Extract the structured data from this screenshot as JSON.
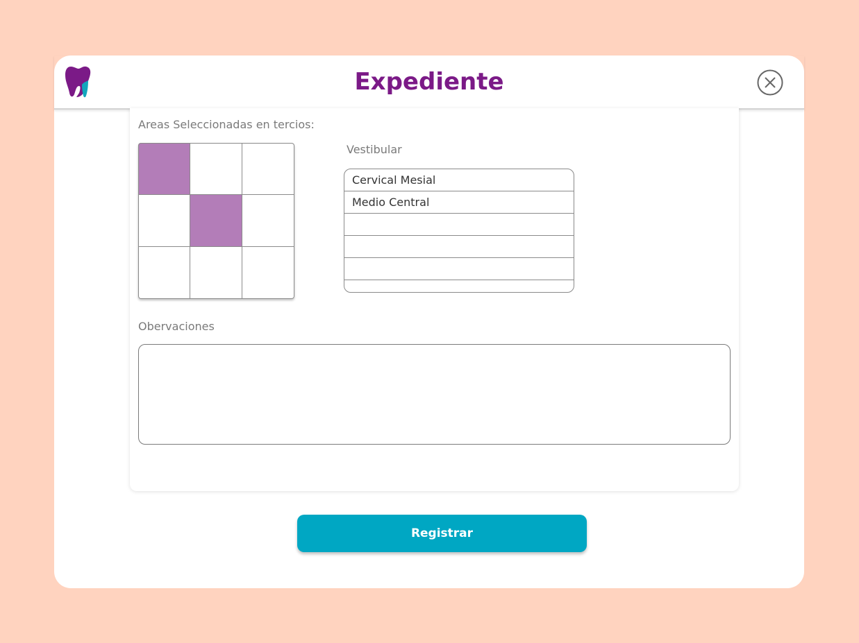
{
  "colors": {
    "background": "#FFD3BF",
    "title": "#7B1A87",
    "selected_cell": "#B37DB8",
    "primary_button": "#00A7C3",
    "logo_purple": "#7B1A87",
    "logo_teal": "#13A6BC"
  },
  "header": {
    "title": "Expediente",
    "logo_icon": "tooth-logo-icon",
    "close_icon": "close-circle-icon"
  },
  "areas": {
    "label": "Areas Seleccionadas en tercios:",
    "grid_selected": [
      [
        true,
        false,
        false
      ],
      [
        false,
        true,
        false
      ],
      [
        false,
        false,
        false
      ]
    ]
  },
  "vestibular": {
    "label": "Vestibular",
    "rows": [
      "Cervical Mesial",
      "Medio Central",
      "",
      "",
      "",
      ""
    ]
  },
  "observaciones": {
    "label": "Obervaciones",
    "value": ""
  },
  "actions": {
    "register_label": "Registrar"
  }
}
